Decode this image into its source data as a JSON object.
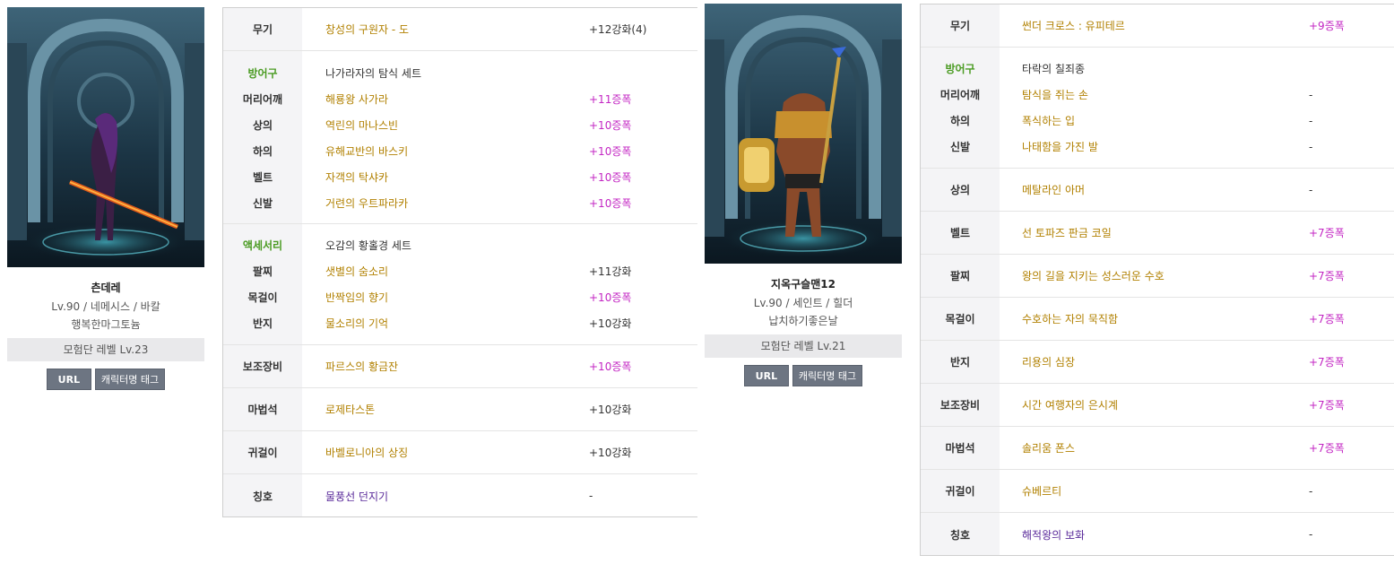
{
  "characters": [
    {
      "name": "츤데레",
      "info": "Lv.90 / 네메시스 / 바칼",
      "guild": "행복한마그토늄",
      "adventure_level": "모험단 레벨 Lv.23",
      "url_label": "URL",
      "tag_label": "캐릭터명 태그",
      "equipment": {
        "weapon": {
          "label": "무기",
          "name": "창성의 구원자 - 도",
          "enh": "+12강화(4)"
        },
        "armor_header": {
          "label": "방어구",
          "name": "나가라자의 탐식 세트"
        },
        "armor": [
          {
            "label": "머리어깨",
            "name": "해룡왕 사가라",
            "enh": "+11증폭"
          },
          {
            "label": "상의",
            "name": "역린의 마나스빈",
            "enh": "+10증폭"
          },
          {
            "label": "하의",
            "name": "유해교반의 바스키",
            "enh": "+10증폭"
          },
          {
            "label": "벨트",
            "name": "자객의 탁샤카",
            "enh": "+10증폭"
          },
          {
            "label": "신발",
            "name": "거련의 우트파라카",
            "enh": "+10증폭"
          }
        ],
        "acc_header": {
          "label": "액세서리",
          "name": "오감의 황홀경 세트"
        },
        "accessories": [
          {
            "label": "팔찌",
            "name": "샛별의 숨소리",
            "enh": "+11강화"
          },
          {
            "label": "목걸이",
            "name": "반짝임의 향기",
            "enh": "+10증폭"
          },
          {
            "label": "반지",
            "name": "물소리의 기억",
            "enh": "+10강화"
          }
        ],
        "sub": {
          "label": "보조장비",
          "name": "파르스의 황금잔",
          "enh": "+10증폭"
        },
        "magic": {
          "label": "마법석",
          "name": "로제타스톤",
          "enh": "+10강화"
        },
        "earring": {
          "label": "귀걸이",
          "name": "바벨로니아의 상징",
          "enh": "+10강화"
        },
        "title": {
          "label": "칭호",
          "name": "물풍선 던지기",
          "enh": "-"
        }
      }
    },
    {
      "name": "지옥구슬맨12",
      "info": "Lv.90 / 세인트 / 힐더",
      "guild": "납치하기좋은날",
      "adventure_level": "모험단 레벨 Lv.21",
      "url_label": "URL",
      "tag_label": "캐릭터명 태그",
      "equipment": {
        "weapon": {
          "label": "무기",
          "name": "썬더 크로스 : 유피테르",
          "enh": "+9증폭"
        },
        "armor_header": {
          "label": "방어구",
          "name": "타락의 칠죄종"
        },
        "armor": [
          {
            "label": "머리어깨",
            "name": "탐식을 쥐는 손",
            "enh": "-"
          },
          {
            "label": "하의",
            "name": "폭식하는 입",
            "enh": "-"
          },
          {
            "label": "신발",
            "name": "나태함을 가진 발",
            "enh": "-"
          }
        ],
        "top": {
          "label": "상의",
          "name": "메탈라인 아머",
          "enh": "-"
        },
        "belt": {
          "label": "벨트",
          "name": "선 토파즈 판금 코일",
          "enh": "+7증폭"
        },
        "bracelet": {
          "label": "팔찌",
          "name": "왕의 길을 지키는 성스러운 수호",
          "enh": "+7증폭"
        },
        "necklace": {
          "label": "목걸이",
          "name": "수호하는 자의 묵직함",
          "enh": "+7증폭"
        },
        "ring": {
          "label": "반지",
          "name": "리용의 심장",
          "enh": "+7증폭"
        },
        "sub": {
          "label": "보조장비",
          "name": "시간 여행자의 은시계",
          "enh": "+7증폭"
        },
        "magic": {
          "label": "마법석",
          "name": "솔리움 폰스",
          "enh": "+7증폭"
        },
        "earring": {
          "label": "귀걸이",
          "name": "슈베르티",
          "enh": "-"
        },
        "title": {
          "label": "칭호",
          "name": "해적왕의 보화",
          "enh": "-"
        }
      }
    }
  ],
  "colors": {
    "set_green": "#4a9b22",
    "item_gold": "#b18000",
    "item_purple": "#5a2a9a",
    "amp_magenta": "#c326c3",
    "label_bg": "#f4f4f6",
    "button_bg": "#6d7582"
  }
}
